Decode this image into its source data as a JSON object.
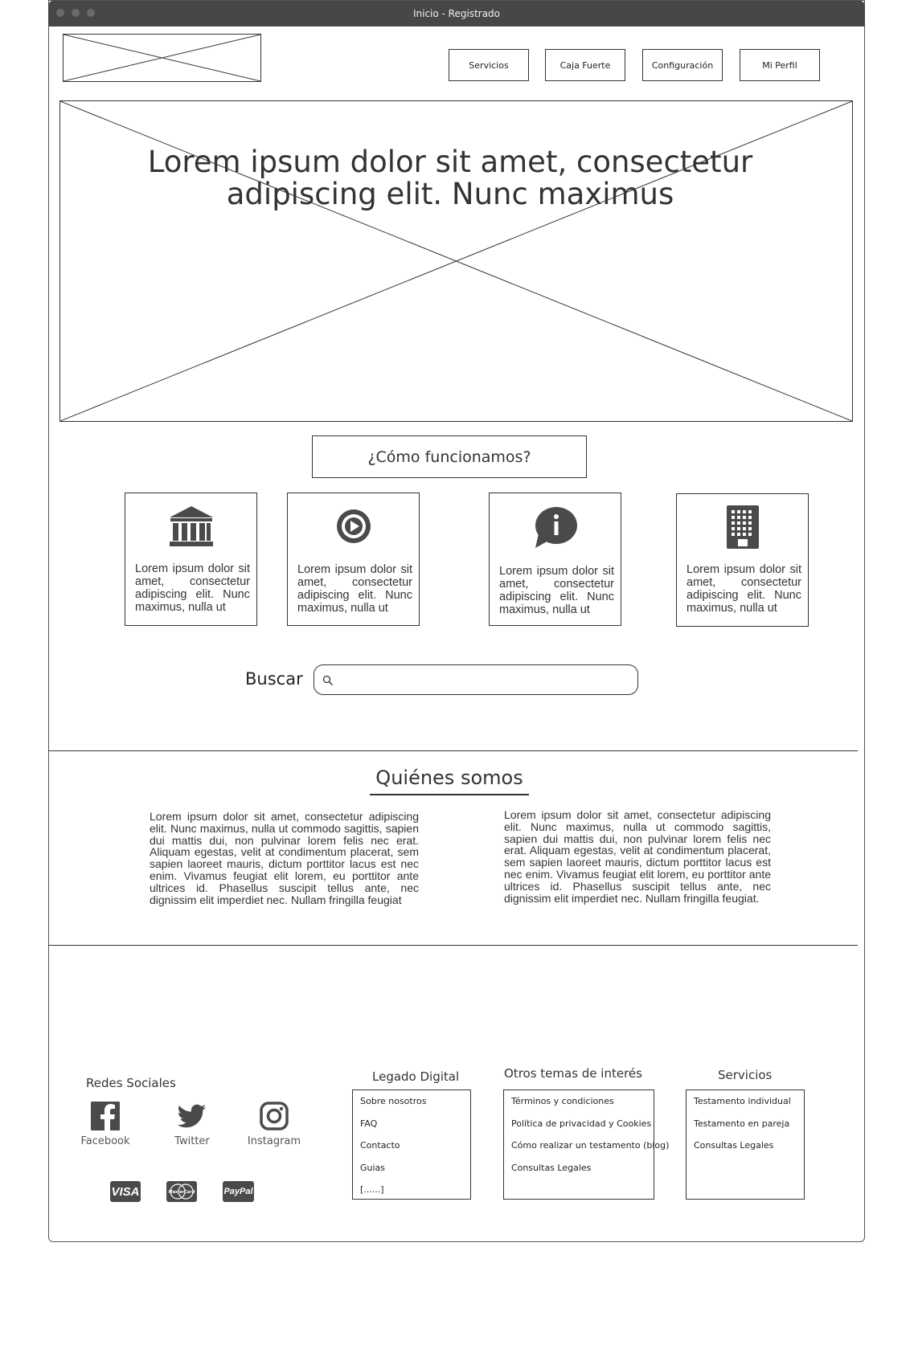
{
  "window": {
    "title": "Inicio - Registrado"
  },
  "nav": {
    "items": [
      "Servicios",
      "Caja Fuerte",
      "Configuración",
      "Mi Perfil"
    ]
  },
  "hero": {
    "title": "Lorem ipsum dolor sit amet, consectetur adipiscing elit. Nunc maximus"
  },
  "how": {
    "label": "¿Cómo funcionamos?"
  },
  "cards": [
    {
      "icon": "bank-icon",
      "text": "Lorem ipsum dolor sit amet, consectetur adipiscing elit. Nunc maximus, nulla ut"
    },
    {
      "icon": "play-circle-icon",
      "text": "Lorem ipsum dolor sit amet, consectetur adipiscing elit. Nunc maximus, nulla ut"
    },
    {
      "icon": "info-bubble-icon",
      "text": "Lorem ipsum dolor sit amet, consectetur adipiscing elit. Nunc maximus, nulla ut"
    },
    {
      "icon": "building-icon",
      "text": "Lorem ipsum dolor sit amet, consectetur adipiscing elit. Nunc maximus, nulla ut"
    }
  ],
  "search": {
    "label": "Buscar",
    "value": ""
  },
  "about": {
    "title": "Quiénes somos",
    "left": "Lorem ipsum dolor sit amet, consectetur adipiscing elit. Nunc maximus, nulla ut commodo sagittis, sapien dui mattis dui, non pulvinar lorem felis nec erat. Aliquam egestas, velit at condimentum placerat, sem sapien laoreet mauris, dictum porttitor lacus est nec enim. Vivamus feugiat elit lorem, eu porttitor ante ultrices id. Phasellus suscipit tellus ante, nec dignissim elit imperdiet nec. Nullam fringilla feugiat",
    "right": "Lorem ipsum dolor sit amet, consectetur adipiscing elit. Nunc maximus, nulla ut commodo sagittis, sapien dui mattis dui, non pulvinar lorem felis nec erat. Aliquam egestas, velit at condimentum placerat, sem sapien laoreet mauris, dictum porttitor lacus est nec enim. Vivamus feugiat elit lorem, eu porttitor ante ultrices id. Phasellus suscipit tellus ante, nec dignissim elit imperdiet nec. Nullam fringilla feugiat."
  },
  "footer": {
    "social": {
      "title": "Redes Sociales",
      "items": [
        {
          "icon": "facebook-icon",
          "label": "Facebook"
        },
        {
          "icon": "twitter-icon",
          "label": "Twitter"
        },
        {
          "icon": "instagram-icon",
          "label": "Instagram"
        }
      ]
    },
    "payments": [
      "VISA",
      "MasterCard",
      "PayPal"
    ],
    "columns": [
      {
        "title": "Legado Digital",
        "links": [
          "Sobre nosotros",
          "FAQ",
          "Contacto",
          "Guias",
          "[......]"
        ]
      },
      {
        "title": "Otros temas de interés",
        "links": [
          "Términos y condiciones",
          "Política de privacidad y Cookies",
          "Cómo realizar un testamento (blog)",
          "Consultas Legales"
        ]
      },
      {
        "title": "Servicios",
        "links": [
          "Testamento individual",
          "Testamento en pareja",
          "Consultas Legales"
        ]
      }
    ]
  },
  "colors": {
    "chrome": "#474747",
    "ink": "#333333",
    "icon": "#4a4a4a"
  }
}
